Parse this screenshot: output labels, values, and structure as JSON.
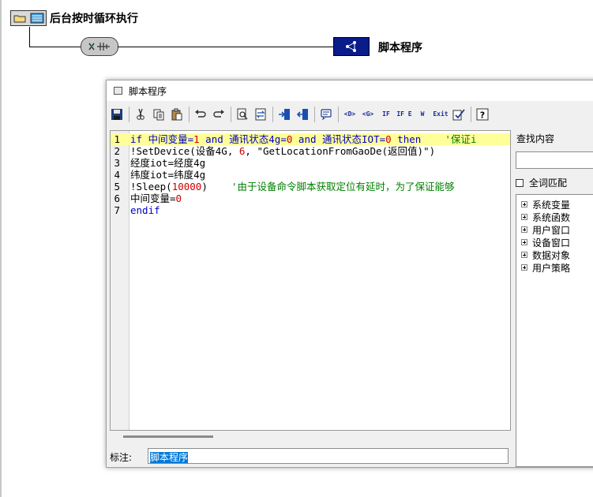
{
  "flow": {
    "title": "后台按时循环执行",
    "script_node_label": "脚本程序"
  },
  "dialog": {
    "title": "脚本程序",
    "toolbar": [
      "save-icon",
      "cut-icon",
      "copy-icon",
      "paste-icon",
      "undo-icon",
      "redo-icon",
      "find-icon",
      "replace-icon",
      "indent-icon",
      "outdent-icon",
      "comment-icon",
      "<D>",
      "<G>",
      "IF",
      "IF-E",
      "W",
      "Exit",
      "check-icon",
      "help-icon"
    ],
    "toolbar_text": {
      "d": "<D>",
      "g": "<G>",
      "if": "IF",
      "ife": "IF E",
      "w": "W",
      "exit": "Exit"
    },
    "editor": {
      "lines": [
        {
          "no": "1",
          "tokens": [
            {
              "t": "if ",
              "c": "kw"
            },
            {
              "t": "中间变量=",
              "c": "kw"
            },
            {
              "t": "1",
              "c": "num"
            },
            {
              "t": " and ",
              "c": "kw"
            },
            {
              "t": "通讯状态4g=",
              "c": "kw"
            },
            {
              "t": "0",
              "c": "num"
            },
            {
              "t": " and ",
              "c": "kw"
            },
            {
              "t": "通讯状态IOT=",
              "c": "kw"
            },
            {
              "t": "0",
              "c": "num"
            },
            {
              "t": " then",
              "c": "kw"
            },
            {
              "t": "    '保证i",
              "c": "cmt"
            }
          ]
        },
        {
          "no": "2",
          "tokens": [
            {
              "t": "!SetDevice(设备4G, ",
              "c": "plain"
            },
            {
              "t": "6",
              "c": "num"
            },
            {
              "t": ", \"GetLocationFromGaoDe(返回值)\")",
              "c": "plain"
            }
          ]
        },
        {
          "no": "3",
          "tokens": [
            {
              "t": "经度iot=经度4g",
              "c": "plain"
            }
          ]
        },
        {
          "no": "4",
          "tokens": [
            {
              "t": "纬度iot=纬度4g",
              "c": "plain"
            }
          ]
        },
        {
          "no": "5",
          "tokens": [
            {
              "t": "!Sleep(",
              "c": "plain"
            },
            {
              "t": "10000",
              "c": "num"
            },
            {
              "t": ")",
              "c": "plain"
            },
            {
              "t": "    '由于设备命令脚本获取定位有延时，为了保证能够",
              "c": "cmt"
            }
          ]
        },
        {
          "no": "6",
          "tokens": [
            {
              "t": "中间变量=",
              "c": "plain"
            },
            {
              "t": "0",
              "c": "num"
            }
          ]
        },
        {
          "no": "7",
          "tokens": [
            {
              "t": "endif",
              "c": "kw"
            }
          ]
        }
      ]
    },
    "remark_label": "标注:",
    "remark_value": "脚本程序",
    "search": {
      "label": "查找内容",
      "value": "",
      "match_label": "全词匹配",
      "match_checked": false
    },
    "tree": [
      "系统变量",
      "系统函数",
      "用户窗口",
      "设备窗口",
      "数据对象",
      "用户策略"
    ]
  },
  "colors": {
    "keyword": "#0000cc",
    "number": "#cc0000",
    "comment": "#008000",
    "highlight": "#ffff99",
    "script_node": "#0a1b8a",
    "selection": "#0078d7"
  }
}
